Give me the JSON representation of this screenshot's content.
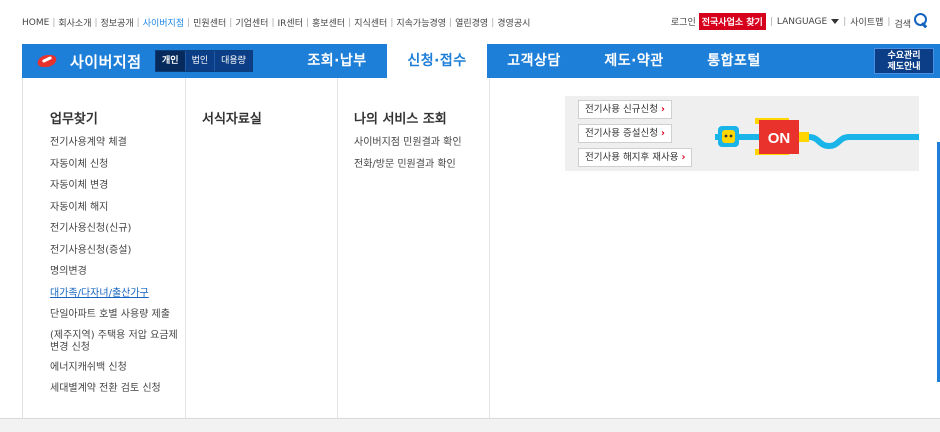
{
  "util_nav": {
    "items": [
      "HOME",
      "회사소개",
      "정보공개",
      "사이버지점",
      "민원센터",
      "기업센터",
      "IR센터",
      "홍보센터",
      "지식센터",
      "지속가능경영",
      "열린경영",
      "경영공시"
    ],
    "active_index": 3
  },
  "util_right": {
    "login": "로그인",
    "branch_search": "전국사업소 찾기",
    "language": "LANGUAGE",
    "sitemap": "사이트맵",
    "search": "검색"
  },
  "brand": {
    "name": "사이버지점",
    "segments": [
      "개인",
      "법인",
      "대용량"
    ],
    "active_segment": 0
  },
  "main_menu": {
    "items": [
      "조회·납부",
      "신청·접수",
      "고객상담",
      "제도·약관",
      "통합포털"
    ],
    "active_index": 1
  },
  "demand_button": {
    "line1": "수요관리",
    "line2": "제도안내"
  },
  "dropdown": {
    "col1": {
      "title": "업무찾기",
      "items": [
        "전기사용계약 체결",
        "자동이체 신청",
        "자동이체 변경",
        "자동이체 해지",
        "전기사용신청(신규)",
        "전기사용신청(증설)",
        "명의변경",
        "대가족/다자녀/출산가구",
        "단일아파트 호별 사용량 제출",
        "(제주지역) 주택용 저압 요금제 변경 신청",
        "에너지캐쉬백 신청",
        "세대별계약 전환 검토 신청"
      ],
      "link_index": 7
    },
    "col2": {
      "title": "서식자료실"
    },
    "col3": {
      "title": "나의 서비스 조회",
      "items": [
        "사이버지점 민원결과 확인",
        "전화/방문 민원결과 확인"
      ]
    }
  },
  "promo": {
    "buttons": [
      "전기사용 신규신청",
      "전기사용 증설신청",
      "전기사용 해지후 재사용"
    ],
    "switch_label": "ON",
    "colors": {
      "switch": "#e8322b",
      "plug": "#ffd600",
      "cable": "#19b5e8"
    }
  },
  "colors": {
    "nav_blue": "#1e7fd8",
    "dark_blue": "#0b3e86",
    "badge_red": "#d6001c"
  }
}
